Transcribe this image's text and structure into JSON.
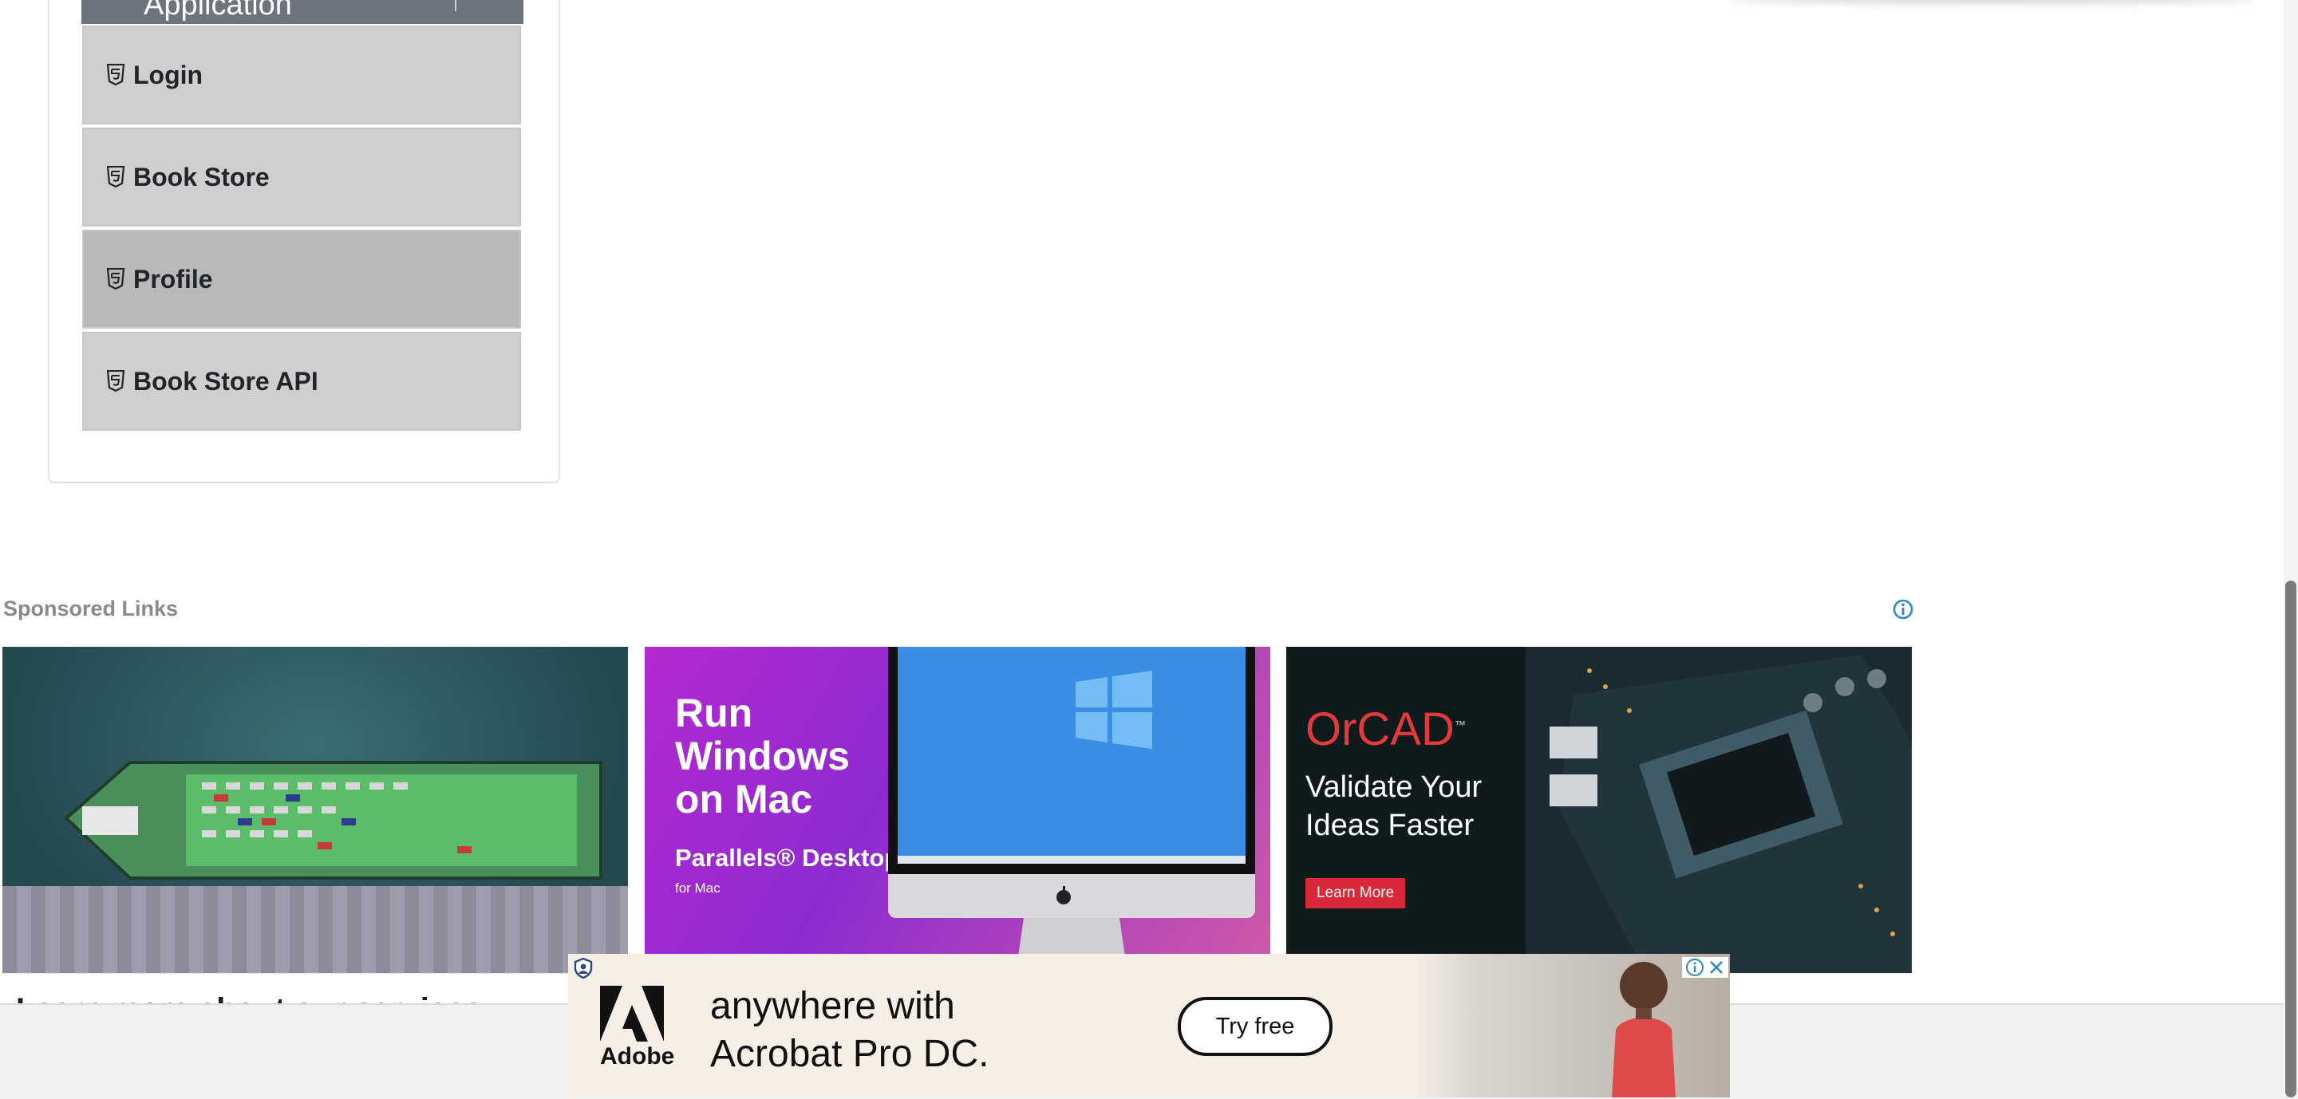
{
  "sidebar": {
    "group_title": "Application",
    "items": [
      {
        "label": "Login"
      },
      {
        "label": "Book Store"
      },
      {
        "label": "Profile"
      },
      {
        "label": "Book Store API"
      }
    ]
  },
  "sponsored": {
    "title": "Sponsored Links",
    "ads": [
      {
        "link_text": "Learn more about our services"
      },
      {
        "headline_lines": [
          "Run",
          "Windows",
          "on Mac"
        ],
        "brand": "Parallels® Desktop",
        "brand_sub": "for Mac"
      },
      {
        "logo": "OrCAD",
        "tagline_lines": [
          "Validate Your",
          "Ideas Faster"
        ],
        "cta": "Learn More"
      }
    ]
  },
  "floating_ad": {
    "brand": "Adobe",
    "copy_lines": [
      "anywhere with",
      "Acrobat Pro DC."
    ],
    "cta": "Try free"
  },
  "colors": {
    "menu_item_bg": "#cfcfcf",
    "menu_item_active_bg": "#b9b9b9",
    "group_header_bg": "#6c757d",
    "orcad_red": "#e23a3a",
    "learn_more_red": "#d8283a",
    "info_blue": "#2a86c9"
  },
  "icons": [
    "html5-icon",
    "info-icon",
    "adchoices-icon",
    "close-icon",
    "apple-icon",
    "windows-logo-icon"
  ]
}
